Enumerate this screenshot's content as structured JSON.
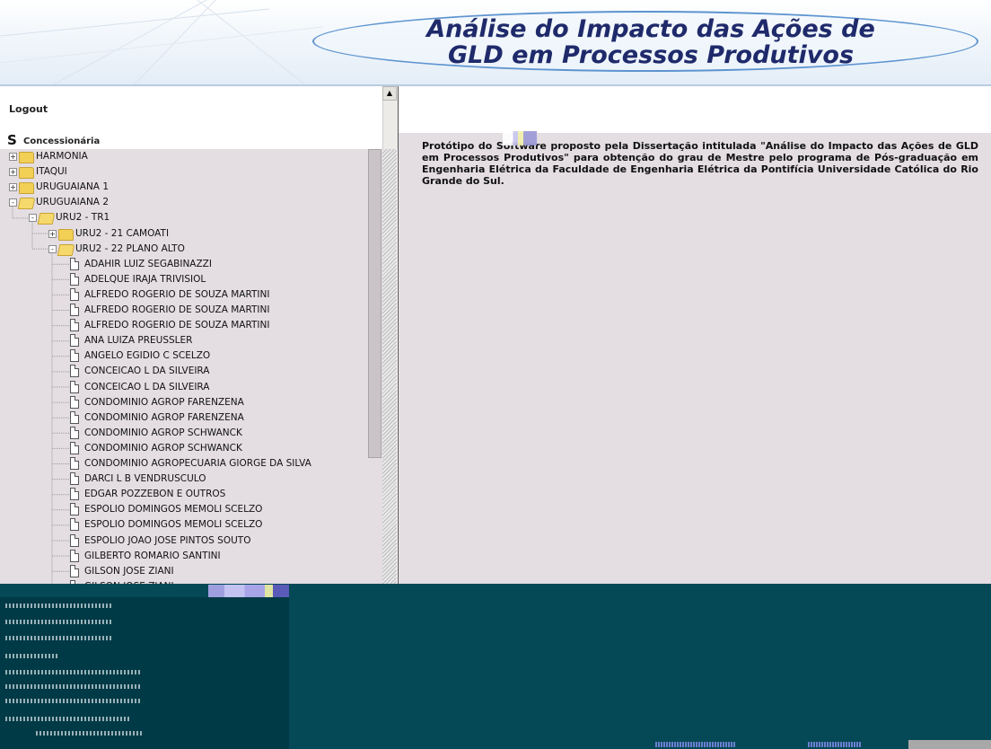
{
  "header": {
    "title": "Análise do Impacto das Ações de\nGLD em Processos Produtivos"
  },
  "sidebar": {
    "scroll_up": "▲",
    "logout_label": "Logout",
    "concessionaria_icon": "S",
    "concessionaria_label": "Concessionária",
    "tree": [
      {
        "label": "HARMONIA",
        "level": 0,
        "icon": "folder",
        "expander": "+"
      },
      {
        "label": "ITAQUI",
        "level": 0,
        "icon": "folder",
        "expander": "+"
      },
      {
        "label": "URUGUAIANA 1",
        "level": 0,
        "icon": "folder",
        "expander": "+"
      },
      {
        "label": "URUGUAIANA 2",
        "level": 0,
        "icon": "folder-open",
        "expander": "-"
      },
      {
        "label": "URU2 - TR1",
        "level": 1,
        "icon": "folder-open",
        "expander": "-"
      },
      {
        "label": "URU2 - 21 CAMOATI",
        "level": 2,
        "icon": "folder",
        "expander": "+"
      },
      {
        "label": "URU2 - 22 PLANO ALTO",
        "level": 2,
        "icon": "folder-open",
        "expander": "-"
      },
      {
        "label": "ADAHIR LUIZ SEGABINAZZI",
        "level": 3,
        "icon": "document"
      },
      {
        "label": "ADELQUE IRAJA TRIVISIOL",
        "level": 3,
        "icon": "document"
      },
      {
        "label": "ALFREDO ROGERIO DE SOUZA MARTINI",
        "level": 3,
        "icon": "document"
      },
      {
        "label": "ALFREDO ROGERIO DE SOUZA MARTINI",
        "level": 3,
        "icon": "document"
      },
      {
        "label": "ALFREDO ROGERIO DE SOUZA MARTINI",
        "level": 3,
        "icon": "document"
      },
      {
        "label": "ANA LUIZA PREUSSLER",
        "level": 3,
        "icon": "document"
      },
      {
        "label": "ANGELO EGIDIO C SCELZO",
        "level": 3,
        "icon": "document"
      },
      {
        "label": "CONCEICAO L DA SILVEIRA",
        "level": 3,
        "icon": "document"
      },
      {
        "label": "CONCEICAO L DA SILVEIRA",
        "level": 3,
        "icon": "document"
      },
      {
        "label": "CONDOMINIO AGROP FARENZENA",
        "level": 3,
        "icon": "document"
      },
      {
        "label": "CONDOMINIO AGROP FARENZENA",
        "level": 3,
        "icon": "document"
      },
      {
        "label": "CONDOMINIO AGROP SCHWANCK",
        "level": 3,
        "icon": "document"
      },
      {
        "label": "CONDOMINIO AGROP SCHWANCK",
        "level": 3,
        "icon": "document"
      },
      {
        "label": "CONDOMINIO AGROPECUARIA GIORGE DA SILVA",
        "level": 3,
        "icon": "document"
      },
      {
        "label": "DARCI L B VENDRUSCULO",
        "level": 3,
        "icon": "document"
      },
      {
        "label": "EDGAR POZZEBON E OUTROS",
        "level": 3,
        "icon": "document"
      },
      {
        "label": "ESPOLIO DOMINGOS MEMOLI SCELZO",
        "level": 3,
        "icon": "document"
      },
      {
        "label": "ESPOLIO DOMINGOS MEMOLI SCELZO",
        "level": 3,
        "icon": "document"
      },
      {
        "label": "ESPOLIO JOAO JOSE PINTOS SOUTO",
        "level": 3,
        "icon": "document"
      },
      {
        "label": "GILBERTO ROMARIO SANTINI",
        "level": 3,
        "icon": "document"
      },
      {
        "label": "GILSON JOSE ZIANI",
        "level": 3,
        "icon": "document"
      },
      {
        "label": "GILSON JOSE ZIANI",
        "level": 3,
        "icon": "document"
      }
    ]
  },
  "main": {
    "description": "Protótipo do Software proposto pela Dissertação intitulada \"Análise do Impacto das Ações de GLD em Processos Produtivos\" para obtenção do grau de Mestre pelo programa de Pós-graduação em Engenharia Elétrica da Faculdade de Engenharia Elétrica da Pontifícia Universidade Católica do Rio Grande do Sul."
  },
  "colors": {
    "title": "#1f2a6b",
    "tree_background": "#e4dde2",
    "folder": "#f2cf55",
    "glitch_band": "#054856"
  }
}
